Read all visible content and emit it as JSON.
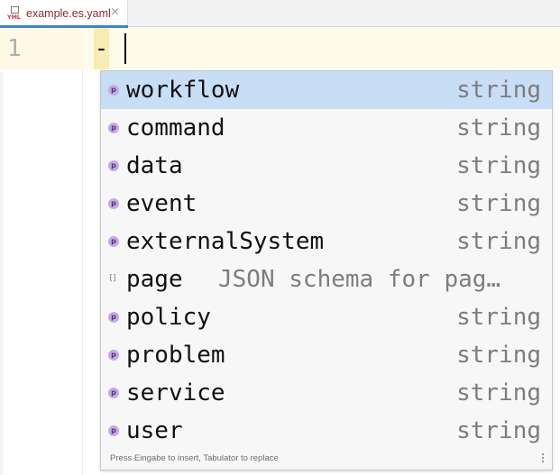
{
  "tab": {
    "file_icon": "yaml-file-icon",
    "file_icon_text": "YML",
    "name": "example.es.yaml",
    "close_glyph": "×"
  },
  "editor": {
    "line_number": "1",
    "line_text": "-"
  },
  "completion": {
    "items": [
      {
        "kind": "p",
        "label": "workflow",
        "type": "string",
        "selected": true
      },
      {
        "kind": "p",
        "label": "command",
        "type": "string"
      },
      {
        "kind": "p",
        "label": "data",
        "type": "string"
      },
      {
        "kind": "p",
        "label": "event",
        "type": "string"
      },
      {
        "kind": "p",
        "label": "externalSystem",
        "type": "string"
      },
      {
        "kind": "[]",
        "label": "page",
        "description": "JSON schema for pag…"
      },
      {
        "kind": "p",
        "label": "policy",
        "type": "string"
      },
      {
        "kind": "p",
        "label": "problem",
        "type": "string"
      },
      {
        "kind": "p",
        "label": "service",
        "type": "string"
      },
      {
        "kind": "p",
        "label": "user",
        "type": "string"
      }
    ],
    "footer_hint": "Press Eingabe to insert, Tabulator to replace",
    "more_icon": "vertical-ellipsis-icon"
  },
  "colors": {
    "selection": "#c8ddf6",
    "caret_line": "#fefbe8",
    "tab_underline": "#4083c9",
    "property_icon": "#c6a8ea"
  }
}
